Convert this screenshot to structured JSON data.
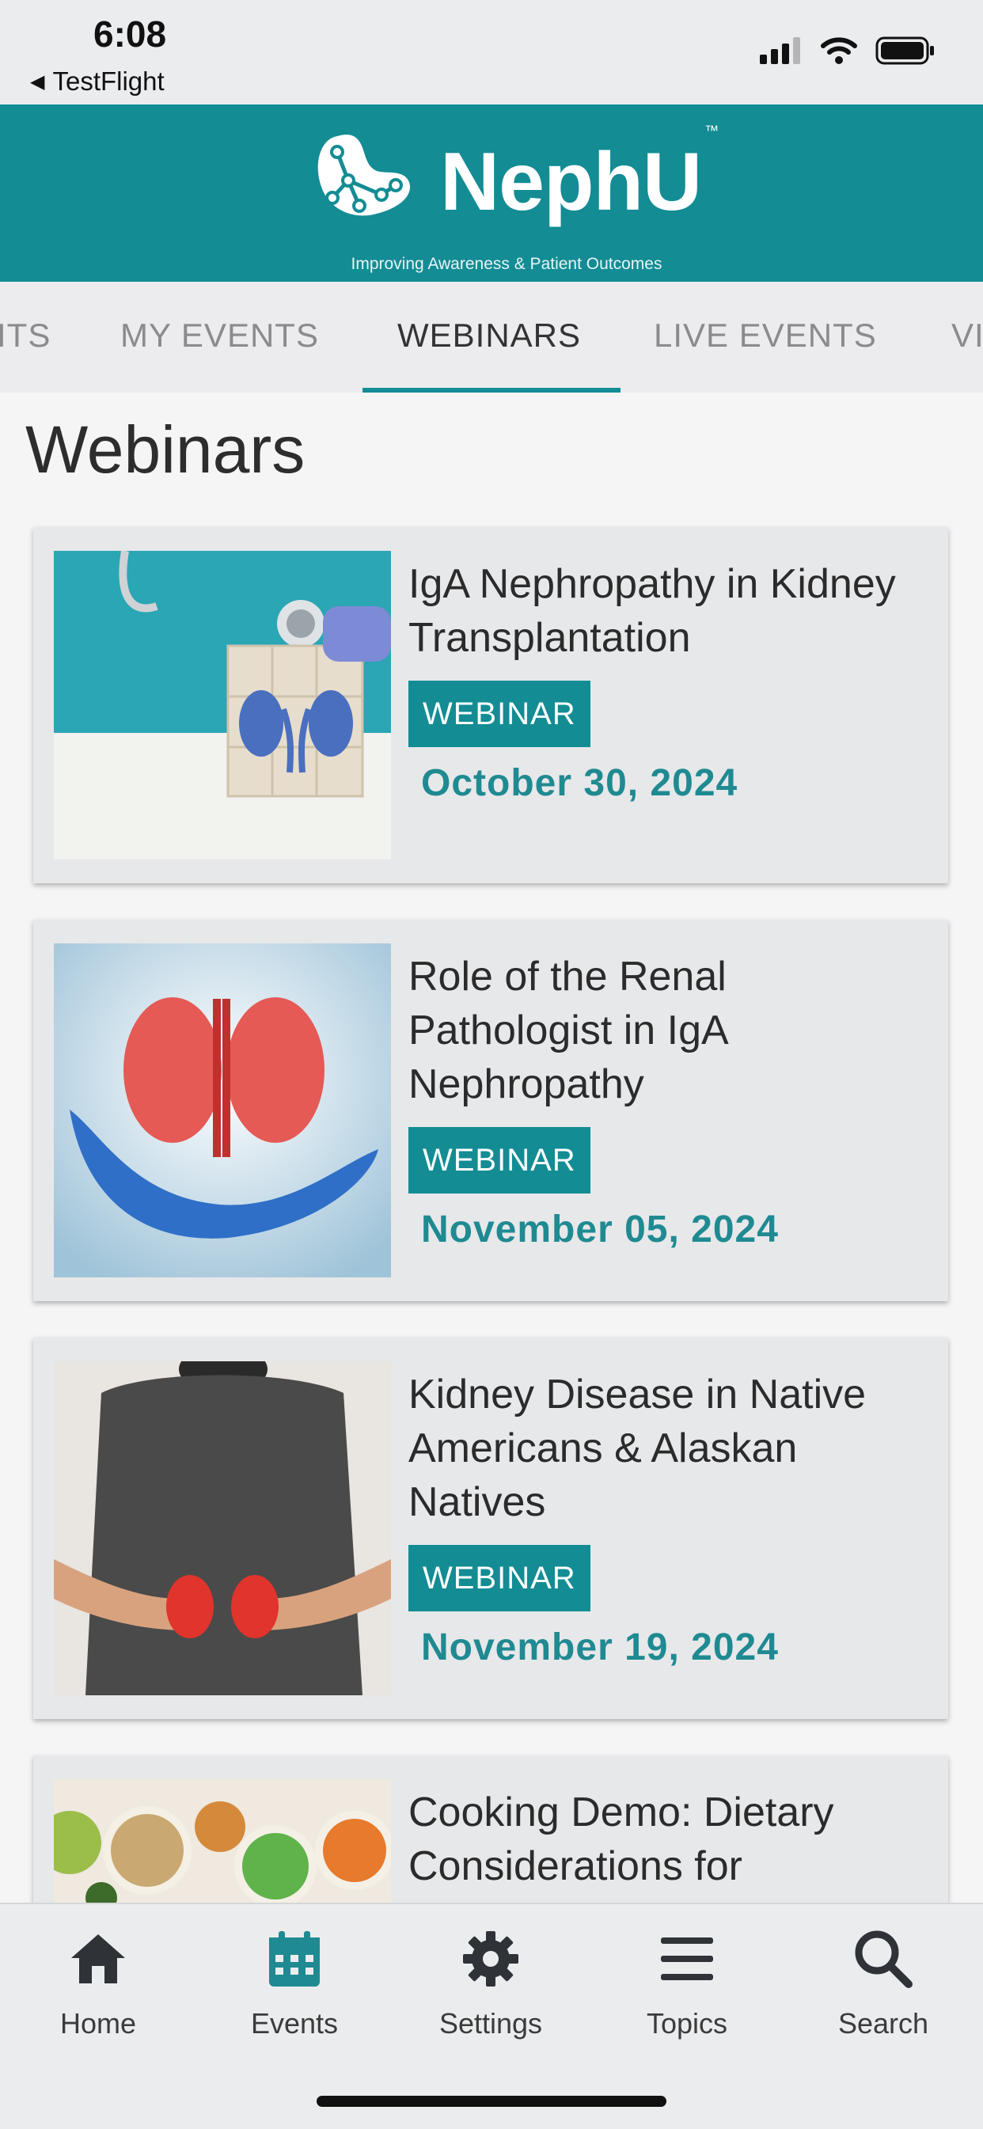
{
  "status_bar": {
    "time": "6:08",
    "back_app": "TestFlight"
  },
  "header": {
    "brand": "NephU",
    "trademark": "™",
    "tagline": "Improving Awareness & Patient Outcomes",
    "color": "#138c94"
  },
  "tabs": [
    {
      "label": "ITS"
    },
    {
      "label": "MY EVENTS"
    },
    {
      "label": "WEBINARS",
      "active": true
    },
    {
      "label": "LIVE EVENTS"
    },
    {
      "label": "VI"
    }
  ],
  "page_title": "Webinars",
  "cards": [
    {
      "title": "IgA Nephropathy in Kidney Transplantation",
      "badge": "WEBINAR",
      "date": "October 30, 2024"
    },
    {
      "title": "Role of the Renal Pathologist in IgA Nephropathy",
      "badge": "WEBINAR",
      "date": "November 05, 2024"
    },
    {
      "title": "Kidney Disease in Native Americans & Alaskan Natives",
      "badge": "WEBINAR",
      "date": "November 19, 2024"
    },
    {
      "title": "Cooking Demo: Dietary Considerations for"
    }
  ],
  "bottom_nav": [
    {
      "label": "Home",
      "icon": "home-icon"
    },
    {
      "label": "Events",
      "icon": "calendar-icon",
      "active": true
    },
    {
      "label": "Settings",
      "icon": "gear-icon"
    },
    {
      "label": "Topics",
      "icon": "menu-icon"
    },
    {
      "label": "Search",
      "icon": "search-icon"
    }
  ]
}
